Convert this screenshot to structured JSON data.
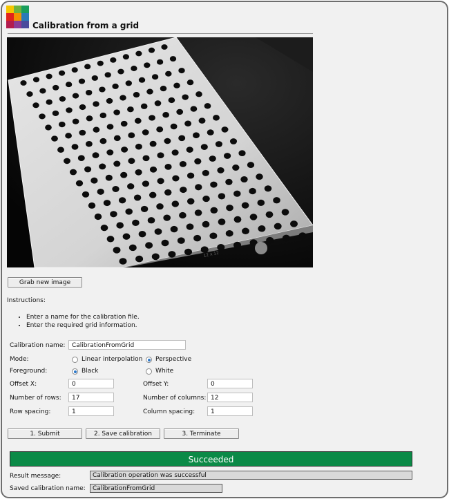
{
  "app": {
    "title": "Calibration from a grid"
  },
  "logo": {
    "colors": [
      "#f7c600",
      "#6fb33f",
      "#1a9e5c",
      "#e1231c",
      "#f39200",
      "#2a7ab8",
      "#b31c4d",
      "#8a3c96",
      "#4a4a9c"
    ]
  },
  "image": {
    "plate_text": "12 x 12"
  },
  "actions": {
    "grab_label": "Grab new image"
  },
  "instructions": {
    "heading": "Instructions:",
    "items": [
      "Enter a name for the calibration file.",
      "Enter the required grid information."
    ]
  },
  "form": {
    "calibration_name_label": "Calibration name:",
    "calibration_name_value": "CalibrationFromGrid",
    "mode_label": "Mode:",
    "mode_options": [
      "Linear interpolation",
      "Perspective"
    ],
    "mode_selected": "Perspective",
    "foreground_label": "Foreground:",
    "foreground_options": [
      "Black",
      "White"
    ],
    "foreground_selected": "Black",
    "offset_x_label": "Offset X:",
    "offset_x_value": "0",
    "offset_y_label": "Offset Y:",
    "offset_y_value": "0",
    "rows_label": "Number of rows:",
    "rows_value": "17",
    "columns_label": "Number of columns:",
    "columns_value": "12",
    "row_spacing_label": "Row spacing:",
    "row_spacing_value": "1",
    "column_spacing_label": "Column spacing:",
    "column_spacing_value": "1"
  },
  "buttons": {
    "submit": "1. Submit",
    "save": "2. Save calibration",
    "terminate": "3. Terminate"
  },
  "status": {
    "banner": "Succeeded",
    "banner_color": "#0b8a47",
    "result_label": "Result message:",
    "result_value": "Calibration operation was successful",
    "saved_label": "Saved calibration name:",
    "saved_value": "CalibrationFromGrid"
  }
}
